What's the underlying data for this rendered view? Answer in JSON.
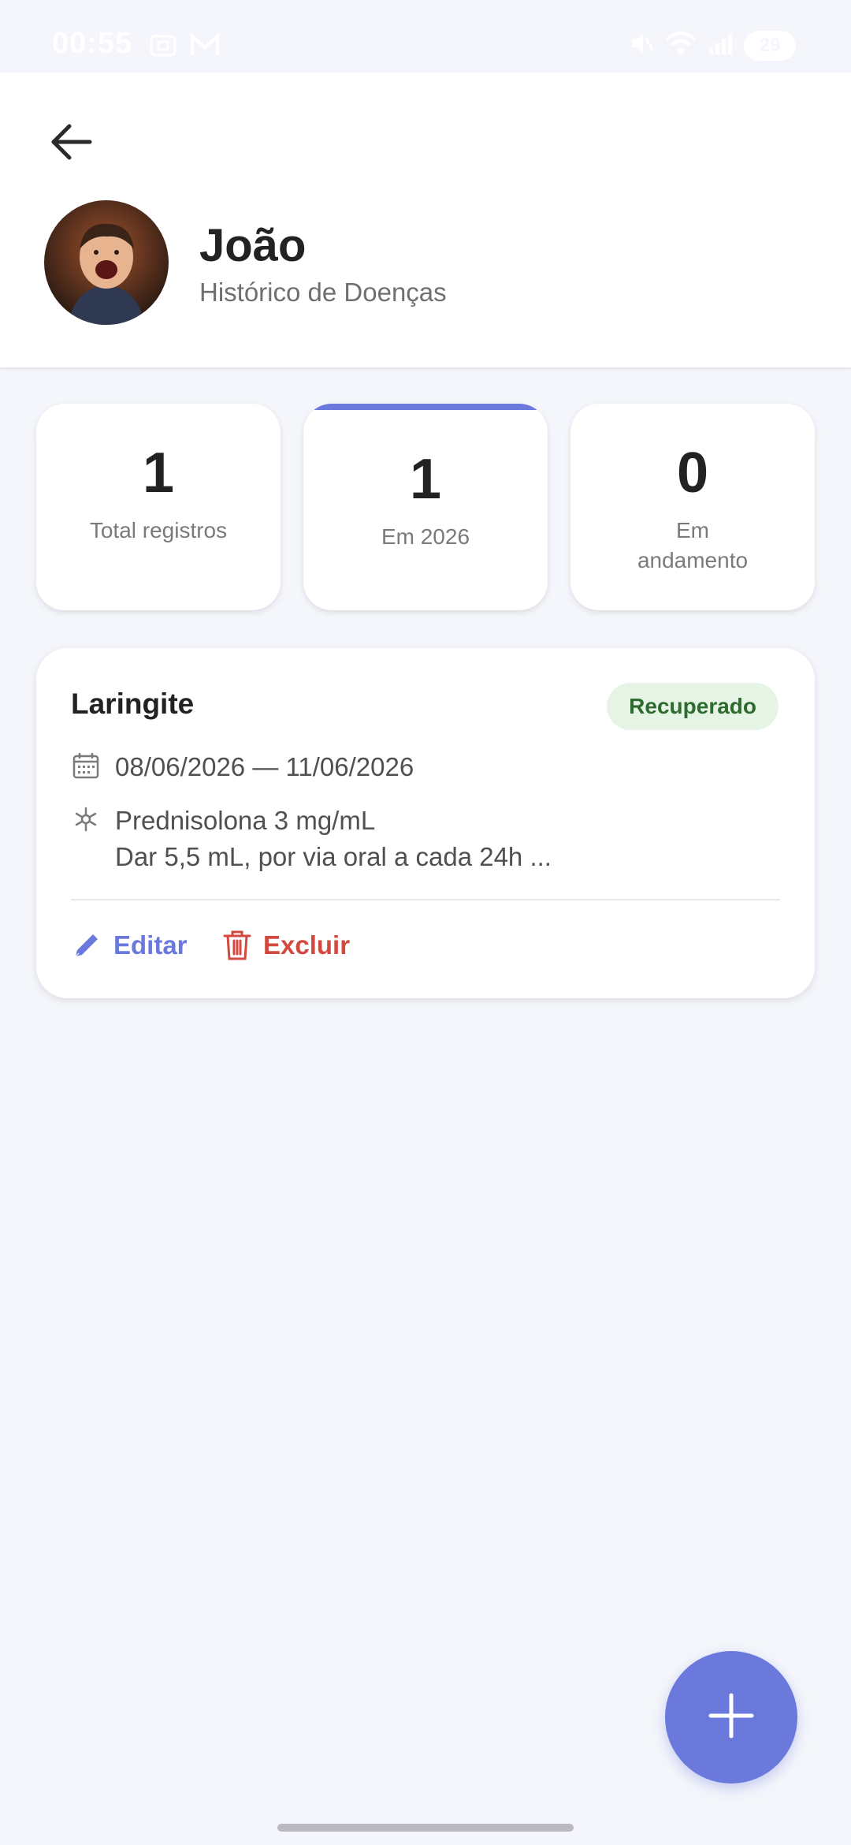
{
  "status_bar": {
    "time": "00:55",
    "battery": "29",
    "left_icons": [
      "screenshot-icon",
      "gmail-icon"
    ],
    "right_icons": [
      "mute-icon",
      "wifi-icon",
      "signal-icon"
    ]
  },
  "header": {
    "back_icon": "arrow-left-icon",
    "name": "João",
    "subtitle": "Histórico de Doenças"
  },
  "stats": [
    {
      "value": "1",
      "label": "Total registros",
      "active": false
    },
    {
      "value": "1",
      "label": "Em 2026",
      "active": true
    },
    {
      "value": "0",
      "label": "Em andamento",
      "active": false
    }
  ],
  "records": [
    {
      "title": "Laringite",
      "status": "Recuperado",
      "date_range": "08/06/2026 — 11/06/2026",
      "medication": "Prednisolona 3 mg/mL",
      "dosage": "Dar 5,5 mL, por via oral a cada 24h ...",
      "edit_label": "Editar",
      "delete_label": "Excluir"
    }
  ],
  "colors": {
    "accent": "#6b79dd",
    "danger": "#d24a3f",
    "badge_bg": "#e6f4e6",
    "badge_text": "#2e6b2e",
    "background": "#f4f6fb"
  },
  "fab": {
    "icon": "plus-icon"
  }
}
